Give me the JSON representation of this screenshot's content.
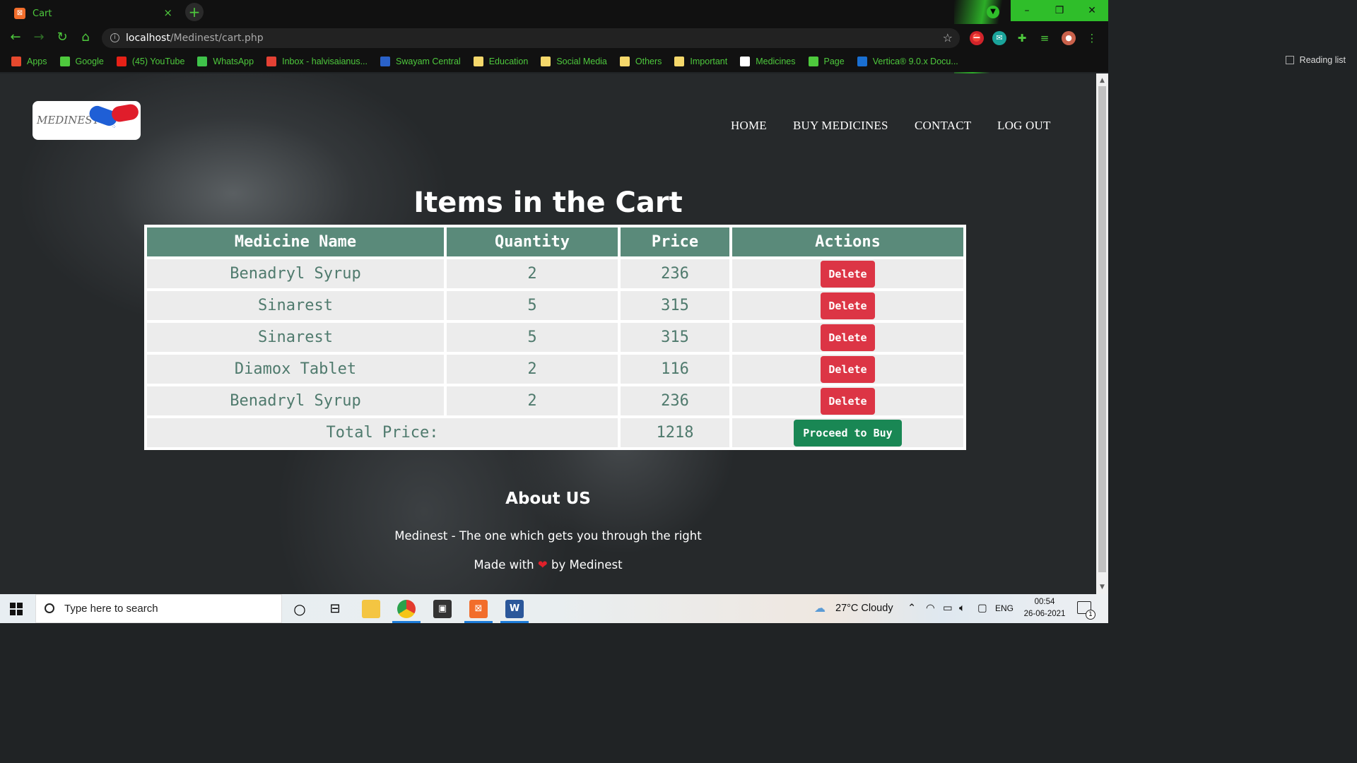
{
  "browser": {
    "tab_title": "Cart",
    "tab_close": "×",
    "new_tab": "+",
    "url_host": "localhost",
    "url_path": "/Medinest/cart.php",
    "window_controls": {
      "minimize": "–",
      "restore": "❐",
      "close": "✕"
    },
    "bookmarks": [
      {
        "label": "Apps",
        "icon": "apps-grid-icon",
        "color": "#e6492e"
      },
      {
        "label": "Google",
        "icon": "google-icon",
        "color": "#4ec93d"
      },
      {
        "label": "(45) YouTube",
        "icon": "youtube-icon",
        "color": "#e62117"
      },
      {
        "label": "WhatsApp",
        "icon": "whatsapp-icon",
        "color": "#3fc24a"
      },
      {
        "label": "Inbox - halvisaianus...",
        "icon": "gmail-icon",
        "color": "#e44134"
      },
      {
        "label": "Swayam Central",
        "icon": "swayam-icon",
        "color": "#2a62c9"
      },
      {
        "label": "Education",
        "icon": "folder-icon",
        "color": "#f5d86b"
      },
      {
        "label": "Social Media",
        "icon": "folder-icon",
        "color": "#f5d86b"
      },
      {
        "label": "Others",
        "icon": "folder-icon",
        "color": "#f5d86b"
      },
      {
        "label": "Important",
        "icon": "folder-icon",
        "color": "#f5d86b"
      },
      {
        "label": "Medicines",
        "icon": "img-icon",
        "color": "#ffffff"
      },
      {
        "label": "Page",
        "icon": "w-icon",
        "color": "#4ec93d"
      },
      {
        "label": "Vertica® 9.0.x Docu...",
        "icon": "vertica-icon",
        "color": "#1a6fd1"
      }
    ],
    "reading_list": "Reading list"
  },
  "site": {
    "logo_text": "MEDINEST",
    "nav": [
      "HOME",
      "BUY MEDICINES",
      "CONTACT",
      "LOG OUT"
    ],
    "heading": "Items in the Cart",
    "table": {
      "headers": [
        "Medicine Name",
        "Quantity",
        "Price",
        "Actions"
      ],
      "rows": [
        {
          "name": "Benadryl Syrup",
          "qty": "2",
          "price": "236",
          "action": "Delete"
        },
        {
          "name": "Sinarest",
          "qty": "5",
          "price": "315",
          "action": "Delete"
        },
        {
          "name": "Sinarest",
          "qty": "5",
          "price": "315",
          "action": "Delete"
        },
        {
          "name": "Diamox Tablet",
          "qty": "2",
          "price": "116",
          "action": "Delete"
        },
        {
          "name": "Benadryl Syrup",
          "qty": "2",
          "price": "236",
          "action": "Delete"
        }
      ],
      "total_label": "Total Price:",
      "total_value": "1218",
      "buy_label": "Proceed to Buy"
    },
    "about_title": "About US",
    "about_text": "Medinest - The one which gets you through the right",
    "made_with_prefix": "Made with",
    "made_with_heart": "❤",
    "made_with_suffix": "by Medinest"
  },
  "taskbar": {
    "search_placeholder": "Type here to search",
    "weather": "27°C  Cloudy",
    "language": "ENG",
    "time": "00:54",
    "date": "26-06-2021",
    "notification_count": "1"
  },
  "colors": {
    "accent_green": "#4ec93d",
    "table_header": "#5a8a7a",
    "delete_button": "#dc3545",
    "buy_button": "#198754"
  }
}
